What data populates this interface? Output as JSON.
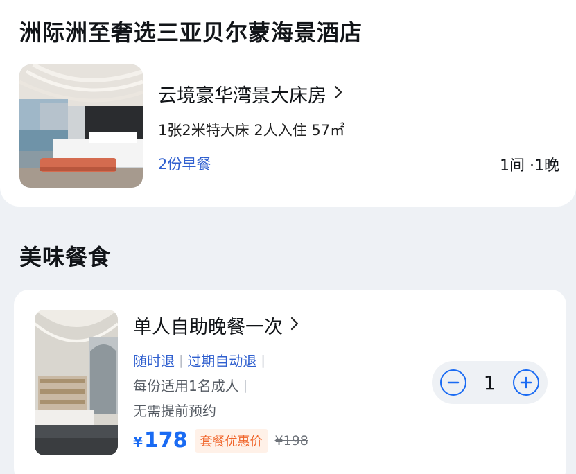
{
  "hotel": {
    "name": "洲际洲至奢选三亚贝尔蒙海景酒店",
    "room": {
      "title": "云境豪华湾景大床房",
      "desc": "1张2米特大床  2人入住  57㎡",
      "breakfast": "2份早餐",
      "nights": "1间 ·1晚"
    }
  },
  "food": {
    "section_title": "美味餐食",
    "item": {
      "name": "单人自助晚餐一次",
      "tag1": "随时退",
      "tag2": "过期自动退",
      "suit": "每份适用1名成人",
      "no_reserve": "无需提前预约",
      "currency": "¥",
      "price": "178",
      "promo": "套餐优惠价",
      "original_price": "¥198",
      "quantity": "1",
      "minus": "−",
      "plus": "+"
    }
  },
  "colors": {
    "accent": "#1a6bf3",
    "link": "#2f5fcf",
    "promo_text": "#f0652b",
    "promo_bg": "#fff1e8",
    "page_bg": "#eef1f5"
  }
}
